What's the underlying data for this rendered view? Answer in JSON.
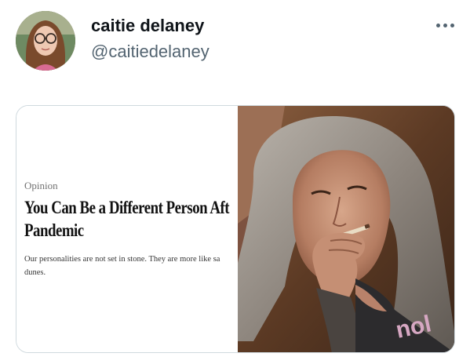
{
  "tweet": {
    "author": {
      "display_name": "caitie delaney",
      "handle": "@caitiedelaney"
    },
    "more_icon": "more-horizontal-icon"
  },
  "media": {
    "article": {
      "section": "Opinion",
      "headline_lines": [
        "You Can Be a Different Person Aft",
        "Pandemic"
      ],
      "summary_lines": [
        "Our personalities are not set in stone. They are more like sa",
        "dunes."
      ]
    },
    "photo": {
      "subject": "woman-smoking-photo",
      "shirt_text": "nol"
    }
  },
  "colors": {
    "name": "#0f1419",
    "handle": "#536471",
    "card_border": "#cfd9de",
    "headline": "#121212",
    "section": "#727272"
  }
}
